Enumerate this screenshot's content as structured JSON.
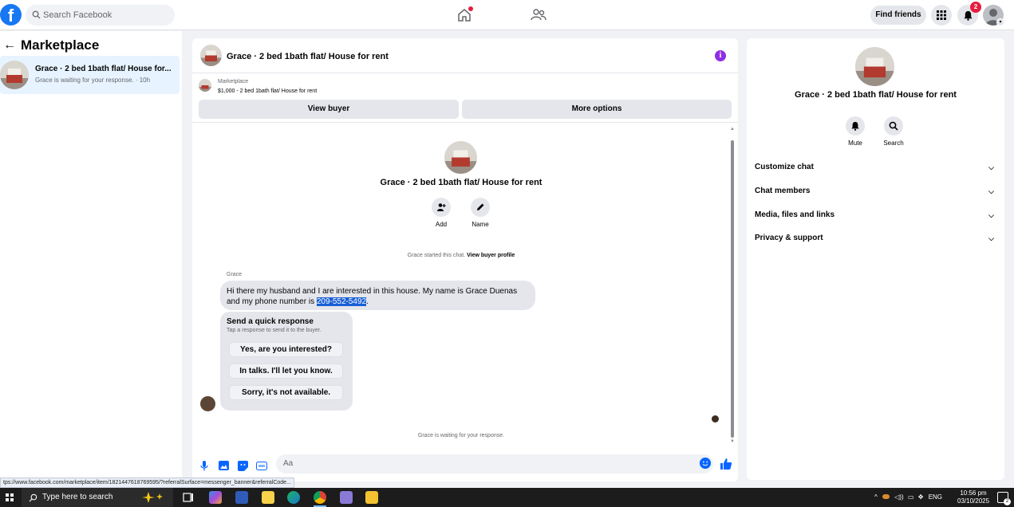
{
  "topbar": {
    "logo": "f",
    "search_placeholder": "Search Facebook",
    "find_friends": "Find friends",
    "notification_count": "2"
  },
  "left": {
    "title": "Marketplace",
    "conversation": {
      "title": "Grace · 2 bed 1bath flat/ House for...",
      "subtitle": "Grace is waiting for your response. · 10h"
    }
  },
  "chat": {
    "title": "Grace · 2 bed 1bath flat/ House for rent",
    "banner": {
      "category": "Marketplace",
      "listing": "$1,000 - 2 bed 1bath flat/ House for rent",
      "view_buyer": "View buyer",
      "more_options": "More options"
    },
    "intro": {
      "title": "Grace · 2 bed 1bath flat/ House for rent",
      "add_label": "Add",
      "name_label": "Name",
      "started_text": "Grace started this chat.",
      "view_profile": "View buyer profile"
    },
    "message": {
      "sender": "Grace",
      "text_before": "Hi there my husband and I are interested in this house. My name is Grace Duenas and my phone number is ",
      "phone": "209-552-5492",
      "text_after": "."
    },
    "quick_response": {
      "title": "Send a quick response",
      "subtitle": "Tap a response to send it to the buyer.",
      "options": [
        "Yes, are you interested?",
        "In talks. I'll let you know.",
        "Sorry, it's not available."
      ]
    },
    "waiting_text": "Grace is waiting for your response.",
    "composer_placeholder": "Aa"
  },
  "right": {
    "title": "Grace · 2 bed 1bath flat/ House for rent",
    "mute_label": "Mute",
    "search_label": "Search",
    "rows": [
      "Customize chat",
      "Chat members",
      "Media, files and links",
      "Privacy & support"
    ]
  },
  "status_url": "tps://www.facebook.com/marketplace/item/1821447618769595/?referralSurface=messenger_banner&referralCode...",
  "taskbar": {
    "search_placeholder": "Type here to search",
    "lang": "ENG",
    "time": "10:56 pm",
    "date": "03/10/2025",
    "notif_count": "2"
  },
  "colors": {
    "brand": "#1877f2",
    "highlight": "#1a5fd6",
    "info": "#8f2fe3",
    "badge": "#e41e3f"
  }
}
